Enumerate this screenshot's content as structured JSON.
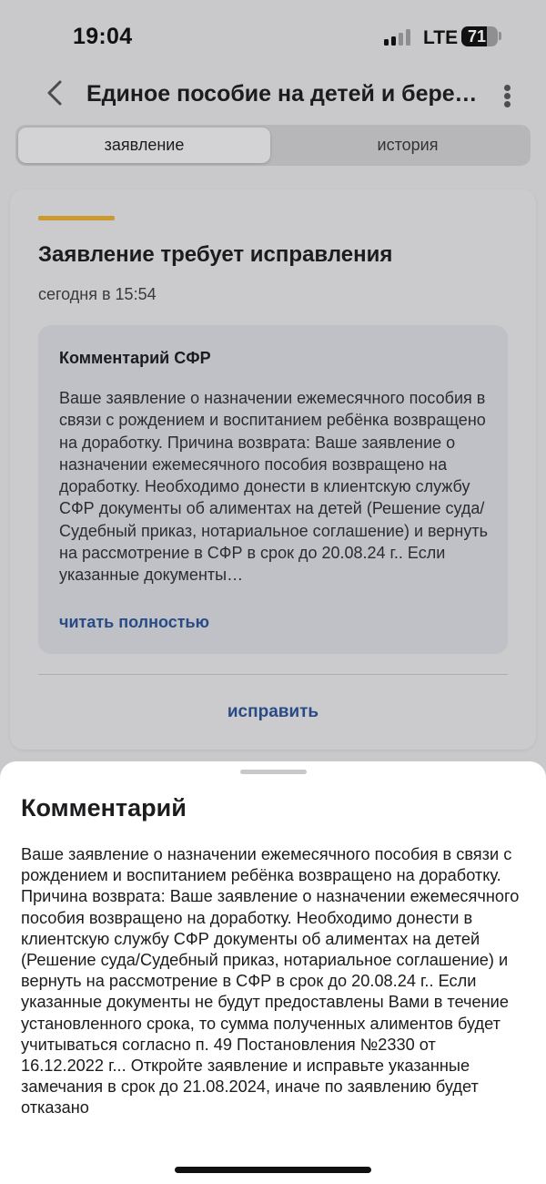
{
  "status_bar": {
    "time": "19:04",
    "network": "LTE",
    "battery": "71",
    "battery_level_percent": 71
  },
  "header": {
    "title": "Единое пособие на детей и беременным",
    "back_icon": "chevron-left-icon",
    "more_icon": "more-vertical-icon"
  },
  "tabs": [
    {
      "label": "заявление",
      "active": true
    },
    {
      "label": "история",
      "active": false
    }
  ],
  "card": {
    "status_title": "Заявление требует исправления",
    "date": "сегодня в 15:54",
    "accent_color": "#c99a2e",
    "comment": {
      "heading": "Комментарий СФР",
      "text": "Ваше заявление о назначении ежемесячного пособия в связи с рождением и воспитанием ребёнка возвращено на доработку. Причина возврата: Ваше заявление о назначении ежемесячного пособия возвращено на доработку. Необходимо донести в клиентскую службу СФР документы об алиментах на детей (Решение суда/Судебный приказ, нотариальное соглашение) и вернуть на рассмотрение в СФР в срок до 20.08.24 г.. Если указанные документы…",
      "read_more": "читать полностью"
    },
    "fix_button": "исправить"
  },
  "sheet": {
    "title": "Комментарий",
    "text": "Ваше заявление о назначении ежемесячного пособия в связи с рождением и воспитанием ребёнка возвращено на доработку. Причина возврата: Ваше заявление о назначении ежемесячного пособия возвращено на доработку. Необходимо донести в клиентскую службу СФР документы об алиментах на детей (Решение суда/Судебный приказ, нотариальное соглашение) и вернуть на рассмотрение в СФР в срок до 20.08.24 г.. Если указанные документы не будут предоставлены Вами в течение установленного срока, то сумма полученных алиментов будет учитываться согласно п. 49 Постановления №2330 от 16.12.2022 г... Откройте заявление и исправьте указанные замечания в срок до 21.08.2024, иначе по заявлению будет отказано"
  },
  "colors": {
    "link": "#284b86",
    "overlay_background": "#c9c9cb",
    "sheet_background": "#ffffff"
  }
}
